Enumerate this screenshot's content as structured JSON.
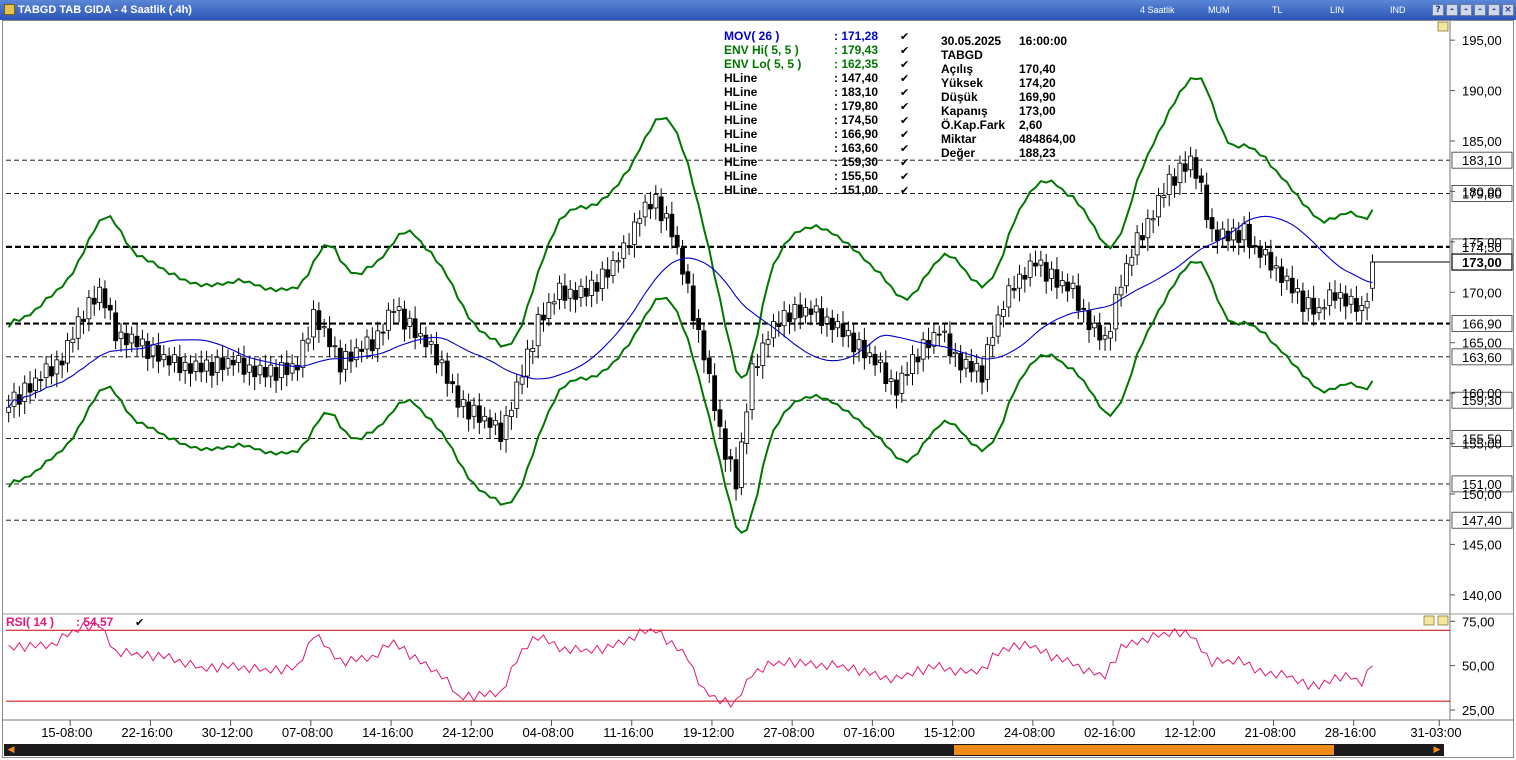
{
  "window": {
    "title": "TABGD TAB GIDA - 4 Saatlik (.4h)",
    "toolbar_labels": [
      "4 Saatlik",
      "MUM",
      "TL",
      "LIN",
      "IND"
    ],
    "title_buttons": [
      "?",
      "-",
      "-",
      "-",
      "-",
      "×"
    ]
  },
  "legend": [
    {
      "name": "MOV( 26 )",
      "value": ": 171,28",
      "color": "#0000cc"
    },
    {
      "name": "ENV Hi( 5, 5 )",
      "value": ": 179,43",
      "color": "#007700"
    },
    {
      "name": "ENV Lo( 5, 5 )",
      "value": ": 162,35",
      "color": "#007700"
    },
    {
      "name": "HLine",
      "value": ": 147,40",
      "color": "#000000"
    },
    {
      "name": "HLine",
      "value": ": 183,10",
      "color": "#000000"
    },
    {
      "name": "HLine",
      "value": ": 179,80",
      "color": "#000000"
    },
    {
      "name": "HLine",
      "value": ": 174,50",
      "color": "#000000"
    },
    {
      "name": "HLine",
      "value": ": 166,90",
      "color": "#000000"
    },
    {
      "name": "HLine",
      "value": ": 163,60",
      "color": "#000000"
    },
    {
      "name": "HLine",
      "value": ": 159,30",
      "color": "#000000"
    },
    {
      "name": "HLine",
      "value": ": 155,50",
      "color": "#000000"
    },
    {
      "name": "HLine",
      "value": ": 151,00",
      "color": "#000000"
    }
  ],
  "info": [
    [
      "30.05.2025",
      "16:00:00"
    ],
    [
      "TABGD",
      ""
    ],
    [
      "Açılış",
      "170,40"
    ],
    [
      "Yüksek",
      "174,20"
    ],
    [
      "Düşük",
      "169,90"
    ],
    [
      "Kapanış",
      "173,00"
    ],
    [
      "Ö.Kap.Fark",
      "2,60"
    ],
    [
      "Miktar",
      "484864,00"
    ],
    [
      "Değer",
      "188,23"
    ]
  ],
  "rsi_label": {
    "name": "RSI( 14 )",
    "value": ": 54,57"
  },
  "chart_data": [
    {
      "type": "candlestick",
      "title": "TABGD TAB GIDA - 4 Saatlik (.4h)",
      "y_axis": {
        "ylim": [
          138.3,
          196.8
        ],
        "ticks": [
          140,
          145,
          150,
          155,
          160,
          165,
          170,
          175,
          180,
          185,
          190,
          195
        ],
        "tick_labels": [
          "140,00",
          "145,00",
          "150,00",
          "155,00",
          "160,00",
          "165,00",
          "170,00",
          "175,00",
          "180,00",
          "185,00",
          "190,00",
          "195,00"
        ]
      },
      "x_axis": {
        "tick_labels": [
          "15-08:00",
          "22-16:00",
          "30-12:00",
          "07-08:00",
          "14-16:00",
          "24-12:00",
          "04-08:00",
          "11-16:00",
          "19-12:00",
          "27-08:00",
          "07-16:00",
          "15-12:00",
          "24-08:00",
          "02-16:00",
          "12-12:00",
          "21-08:00",
          "28-16:00",
          "31-03:00"
        ],
        "tick_index": [
          12,
          27,
          42,
          57,
          72,
          87,
          102,
          117,
          132,
          147,
          162,
          177,
          192,
          207,
          222,
          237,
          252,
          268
        ]
      },
      "hlines": [
        {
          "value": 183.1,
          "label": "183,10",
          "style": "thin-dashed"
        },
        {
          "value": 179.8,
          "label": "179,80",
          "style": "thin-dashed"
        },
        {
          "value": 174.5,
          "label": "174,50",
          "style": "bold-dashed"
        },
        {
          "value": 166.9,
          "label": "166,90",
          "style": "bold-dashed"
        },
        {
          "value": 163.6,
          "label": "163,60",
          "style": "thin-dashed"
        },
        {
          "value": 159.3,
          "label": "159,30",
          "style": "thin-dashed"
        },
        {
          "value": 155.5,
          "label": "155,50",
          "style": "thin-dashed"
        },
        {
          "value": 151.0,
          "label": "151,00",
          "style": "thin-dashed"
        },
        {
          "value": 147.4,
          "label": "147,40",
          "style": "thin-dashed"
        }
      ],
      "last_price": {
        "value": 173.0,
        "label": "173,00"
      },
      "close_series": {
        "name": "Kapanış",
        "keyframes": [
          [
            0,
            159
          ],
          [
            5,
            161
          ],
          [
            10,
            163.5
          ],
          [
            14,
            168
          ],
          [
            17,
            170
          ],
          [
            20,
            166
          ],
          [
            24,
            165
          ],
          [
            30,
            163
          ],
          [
            36,
            162.5
          ],
          [
            42,
            163
          ],
          [
            48,
            162
          ],
          [
            54,
            162.5
          ],
          [
            57,
            168
          ],
          [
            62,
            163
          ],
          [
            68,
            165
          ],
          [
            72,
            168.5
          ],
          [
            76,
            166
          ],
          [
            81,
            163
          ],
          [
            84,
            159
          ],
          [
            87,
            158
          ],
          [
            92,
            156
          ],
          [
            96,
            162
          ],
          [
            99,
            167
          ],
          [
            103,
            170
          ],
          [
            108,
            170
          ],
          [
            112,
            172
          ],
          [
            115,
            174
          ],
          [
            118,
            178
          ],
          [
            121,
            179
          ],
          [
            124,
            176
          ],
          [
            127,
            170
          ],
          [
            130,
            164
          ],
          [
            133,
            156
          ],
          [
            136,
            151
          ],
          [
            139,
            162
          ],
          [
            142,
            166
          ],
          [
            146,
            168
          ],
          [
            150,
            168
          ],
          [
            154,
            167
          ],
          [
            158,
            165
          ],
          [
            162,
            163
          ],
          [
            166,
            160.5
          ],
          [
            170,
            164
          ],
          [
            174,
            166
          ],
          [
            178,
            163
          ],
          [
            182,
            162
          ],
          [
            184,
            166
          ],
          [
            188,
            171
          ],
          [
            192,
            173
          ],
          [
            196,
            171
          ],
          [
            199,
            170
          ],
          [
            202,
            167
          ],
          [
            205,
            165
          ],
          [
            208,
            171
          ],
          [
            211,
            175
          ],
          [
            214,
            178
          ],
          [
            217,
            181
          ],
          [
            219,
            182
          ],
          [
            221,
            183
          ],
          [
            223,
            180
          ],
          [
            225,
            176
          ],
          [
            228,
            175.5
          ],
          [
            231,
            176
          ],
          [
            233,
            174
          ],
          [
            236,
            173
          ],
          [
            239,
            171
          ],
          [
            242,
            169
          ],
          [
            245,
            168
          ],
          [
            248,
            170
          ],
          [
            251,
            169
          ],
          [
            253,
            168
          ],
          [
            255,
            172
          ],
          [
            256,
            173
          ]
        ],
        "wiggle": [
          0.8,
          -0.7,
          0.5,
          -0.4,
          0.9,
          -0.9,
          0.3,
          -0.5,
          0.6,
          -0.2,
          0.7,
          -0.8
        ]
      },
      "moving_average": {
        "name": "MOV( 26 )",
        "period": 26,
        "color": "#0000cc",
        "last": 171.28
      },
      "envelope": {
        "name": "ENV Hi( 5, 5 ) / ENV Lo( 5, 5 )",
        "period": 5,
        "percent": 5,
        "color": "#007700",
        "hi_last": 179.43,
        "lo_last": 162.35
      },
      "visible_bars": 256,
      "total_slots": 270
    },
    {
      "type": "line",
      "title": "RSI( 14 )",
      "last": 54.57,
      "y_axis": {
        "ylim": [
          20.5,
          78
        ],
        "ticks": [
          25,
          50,
          75
        ],
        "tick_labels": [
          "25,00",
          "50,00",
          "75,00"
        ]
      },
      "reference_lines": [
        30,
        70
      ],
      "keyframes": [
        [
          0,
          60
        ],
        [
          8,
          62
        ],
        [
          14,
          72
        ],
        [
          17,
          73
        ],
        [
          20,
          58
        ],
        [
          24,
          56
        ],
        [
          30,
          55
        ],
        [
          36,
          48
        ],
        [
          42,
          50
        ],
        [
          48,
          47
        ],
        [
          54,
          49
        ],
        [
          57,
          68
        ],
        [
          62,
          52
        ],
        [
          68,
          55
        ],
        [
          72,
          63
        ],
        [
          76,
          54
        ],
        [
          81,
          45
        ],
        [
          84,
          32
        ],
        [
          87,
          33
        ],
        [
          92,
          35
        ],
        [
          96,
          58
        ],
        [
          99,
          67
        ],
        [
          103,
          60
        ],
        [
          108,
          58
        ],
        [
          112,
          60
        ],
        [
          118,
          68
        ],
        [
          121,
          70
        ],
        [
          124,
          62
        ],
        [
          127,
          55
        ],
        [
          130,
          35
        ],
        [
          133,
          30
        ],
        [
          136,
          29
        ],
        [
          139,
          46
        ],
        [
          142,
          50
        ],
        [
          146,
          52
        ],
        [
          150,
          51
        ],
        [
          154,
          50
        ],
        [
          158,
          48
        ],
        [
          162,
          45
        ],
        [
          166,
          42
        ],
        [
          170,
          47
        ],
        [
          174,
          50
        ],
        [
          178,
          46
        ],
        [
          182,
          47
        ],
        [
          184,
          55
        ],
        [
          188,
          62
        ],
        [
          192,
          60
        ],
        [
          196,
          54
        ],
        [
          199,
          52
        ],
        [
          202,
          46
        ],
        [
          205,
          44
        ],
        [
          208,
          60
        ],
        [
          211,
          64
        ],
        [
          214,
          66
        ],
        [
          217,
          68
        ],
        [
          219,
          69
        ],
        [
          221,
          67
        ],
        [
          223,
          60
        ],
        [
          225,
          52
        ],
        [
          228,
          52
        ],
        [
          231,
          53
        ],
        [
          233,
          47
        ],
        [
          236,
          46
        ],
        [
          239,
          44
        ],
        [
          242,
          40
        ],
        [
          245,
          38
        ],
        [
          248,
          44
        ],
        [
          251,
          43
        ],
        [
          253,
          40
        ],
        [
          255,
          50
        ],
        [
          256,
          54.57
        ]
      ]
    }
  ],
  "colors": {
    "up": "#ffffff",
    "down": "#000000",
    "envelope": "#007700",
    "mov": "#0000cc",
    "rsi": "#e0187a",
    "rsi_ref": "#cc0000",
    "label": "#000000"
  }
}
